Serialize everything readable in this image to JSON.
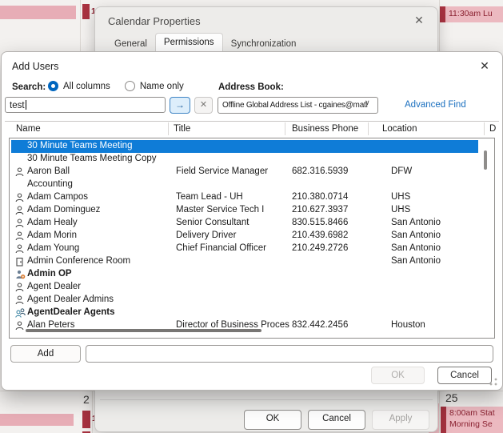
{
  "calendar": {
    "dates": {
      "day_a": "2",
      "day_b": "25"
    },
    "events": {
      "top_day_marker": "1",
      "top_right": "11:30am Lu",
      "bottom_day_marker": "1",
      "bottom_right_line1": "8:00am Stat",
      "bottom_right_line2": "Morning Se"
    },
    "colors": {
      "event_pink": "#ecb9c0",
      "event_accent": "#a83240",
      "event_text": "#8a2130"
    }
  },
  "calendar_properties": {
    "title": "Calendar Properties",
    "close_glyph": "✕",
    "tabs": [
      {
        "label": "General",
        "active": false
      },
      {
        "label": "Permissions",
        "active": true
      },
      {
        "label": "Synchronization",
        "active": false
      }
    ],
    "ok_label": "OK",
    "cancel_label": "Cancel",
    "apply_label": "Apply"
  },
  "add_users": {
    "title": "Add Users",
    "close_glyph": "✕",
    "search": {
      "label": "Search:",
      "options": [
        {
          "label": "All columns",
          "selected": true
        },
        {
          "label": "Name only",
          "selected": false
        }
      ],
      "value": "test",
      "go_glyph": "→",
      "clear_glyph": "✕"
    },
    "address_book": {
      "label": "Address Book:",
      "value": "Offline Global Address List - cgaines@mati",
      "chevron_glyph": "∨",
      "advanced_find_label": "Advanced Find"
    },
    "table": {
      "columns": [
        "Name",
        "Title",
        "Business Phone",
        "Location",
        "D"
      ],
      "rows": [
        {
          "icon": "none",
          "name": "30 Minute Teams Meeting",
          "title": "",
          "phone": "",
          "location": "",
          "bold": false,
          "selected": true
        },
        {
          "icon": "none",
          "name": "30 Minute Teams Meeting Copy",
          "title": "",
          "phone": "",
          "location": "",
          "bold": false,
          "selected": false
        },
        {
          "icon": "person",
          "name": "Aaron Ball",
          "title": "Field Service Manager",
          "phone": "682.316.5939",
          "location": "DFW",
          "bold": false,
          "selected": false
        },
        {
          "icon": "none",
          "name": "Accounting",
          "title": "",
          "phone": "",
          "location": "",
          "bold": false,
          "selected": false
        },
        {
          "icon": "person",
          "name": "Adam Campos",
          "title": "Team Lead - UH",
          "phone": "210.380.0714",
          "location": "UHS",
          "bold": false,
          "selected": false
        },
        {
          "icon": "person",
          "name": "Adam Dominguez",
          "title": "Master Service Tech I",
          "phone": "210.627.3937",
          "location": "UHS",
          "bold": false,
          "selected": false
        },
        {
          "icon": "person",
          "name": "Adam Healy",
          "title": "Senior Consultant",
          "phone": "830.515.8466",
          "location": "San Antonio",
          "bold": false,
          "selected": false
        },
        {
          "icon": "person",
          "name": "Adam Morin",
          "title": "Delivery Driver",
          "phone": "210.439.6982",
          "location": "San Antonio",
          "bold": false,
          "selected": false
        },
        {
          "icon": "person",
          "name": "Adam Young",
          "title": "Chief Financial Officer",
          "phone": "210.249.2726",
          "location": "San Antonio",
          "bold": false,
          "selected": false
        },
        {
          "icon": "room",
          "name": "Admin Conference Room",
          "title": "",
          "phone": "",
          "location": "San Antonio",
          "bold": false,
          "selected": false
        },
        {
          "icon": "group-color",
          "name": "Admin OP",
          "title": "",
          "phone": "",
          "location": "",
          "bold": true,
          "selected": false
        },
        {
          "icon": "person",
          "name": "Agent Dealer",
          "title": "",
          "phone": "",
          "location": "",
          "bold": false,
          "selected": false
        },
        {
          "icon": "person",
          "name": "Agent Dealer Admins",
          "title": "",
          "phone": "",
          "location": "",
          "bold": false,
          "selected": false
        },
        {
          "icon": "group",
          "name": "AgentDealer Agents",
          "title": "",
          "phone": "",
          "location": "",
          "bold": true,
          "selected": false
        },
        {
          "icon": "person",
          "name": "Alan Peters",
          "title": "Director of Business Proces",
          "phone": "832.442.2456",
          "location": "Houston",
          "bold": false,
          "selected": false
        }
      ]
    },
    "add_button_label": "Add",
    "recipients_value": "",
    "ok_label": "OK",
    "cancel_label": "Cancel",
    "selection_color": "#0f7cd7"
  }
}
